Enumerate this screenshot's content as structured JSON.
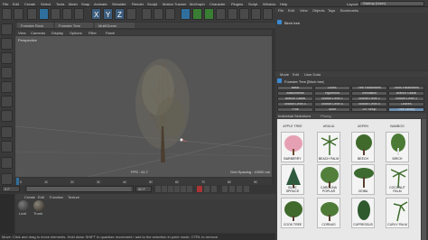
{
  "menu": {
    "file": "File",
    "edit": "Edit",
    "create": "Create",
    "select": "Select",
    "tools": "Tools",
    "mesh": "Mesh",
    "snap": "Snap",
    "animate": "Animate",
    "simulate": "Simulate",
    "render": "Render",
    "sculpt": "Sculpt",
    "motion_tracker": "Motion Tracker",
    "mograph": "MoGraph",
    "character": "Character",
    "plugins": "Plugins",
    "script": "Script",
    "window": "Window",
    "help": "Help",
    "layout_label": "Layout:",
    "layout_value": "Startup (User)"
  },
  "tabs": {
    "tab1": "Forester Rock",
    "tab2": "Forester Tree",
    "tab3": "MultiCloner"
  },
  "viewport": {
    "menu": [
      "View",
      "Cameras",
      "Display",
      "Options",
      "Filter",
      "Panel"
    ],
    "label": "Perspective",
    "fps": "FPS : 41.7",
    "grid": "Grid Spacing : 10000 cm"
  },
  "objects": {
    "menu": [
      "File",
      "Edit",
      "View",
      "Objects",
      "Tags",
      "Bookmarks"
    ],
    "item": "Birch tree"
  },
  "attributes": {
    "menu": [
      "Mode",
      "Edit",
      "User Data"
    ],
    "object_title": "Forester Tree [Birch tree]",
    "row1": [
      "Basic",
      "Coord.",
      "Tree Parameters",
      "Trunk Parameters"
    ],
    "row2": [
      "Attachments",
      "Hyperbind",
      "Simulation",
      "Branch Global"
    ],
    "row3": [
      "Branch Global",
      "Branch Level 1",
      "Branch Level 2",
      "Branch Level 3"
    ],
    "row4": [
      "Branch Level 4",
      "Branch Level 5",
      "Branch Level 6",
      "Leaves"
    ],
    "row5": [
      "Fruit",
      "Store",
      "UV Setup",
      "Tree Library"
    ],
    "section": "Individual Selections",
    "section_value": "Phong"
  },
  "library": {
    "row1": [
      "APPLE TREE",
      "ARALIA",
      "ASPEN",
      "BAMBOO"
    ],
    "row2": [
      "BARBERRY",
      "BEACH PALM",
      "BEECH",
      "BIRCH"
    ],
    "row3": [
      "BLUE SPRUCE",
      "CAROLINA POPLAR",
      "CEIBA",
      "COCONUT PALM"
    ],
    "row4": [
      "COOK TREE",
      "CORNUS",
      "CUPRESSUS",
      "CURLY PALM"
    ]
  },
  "timeline": {
    "ticks": [
      "0",
      "10",
      "20",
      "30",
      "40",
      "50",
      "60",
      "70",
      "80",
      "90"
    ],
    "start": "0 F",
    "end": "90 F"
  },
  "materials": {
    "menu": [
      "Create",
      "Edit",
      "Function",
      "Texture"
    ],
    "mat1": "Leaf",
    "mat2": "Trunk"
  },
  "status": "Move: Click and drag to move elements. Hold down SHIFT to quantize movement / add to the selection in point mode, CTRL to remove.",
  "colors": {
    "accent_blue": "#2f6f9e",
    "selected_tab": "#6d8fb3",
    "viewport_bg": "#555555"
  }
}
